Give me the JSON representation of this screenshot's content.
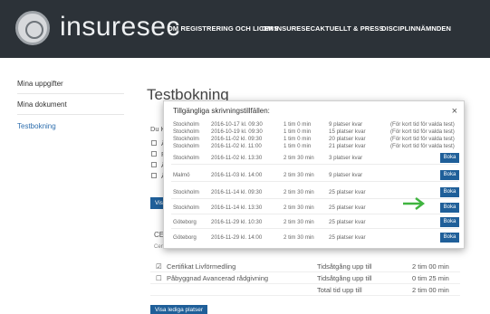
{
  "header": {
    "brand": "insuresec",
    "nav": [
      "OM REGISTRERING OCH LICENS",
      "OM INSURESEC",
      "AKTUELLT & PRESS",
      "DISCIPLINNÄMNDEN"
    ]
  },
  "sidebar": {
    "items": [
      {
        "label": "Mina uppgifter"
      },
      {
        "label": "Mina dokument"
      },
      {
        "label": "Testbokning"
      }
    ]
  },
  "page": {
    "title": "Testbokning",
    "intro_partial": "Du K",
    "checks_partial": [
      "Å",
      "P",
      "Å",
      "Å"
    ],
    "visa_button_partial": "Visa",
    "cert_partial": "CER",
    "cert_sub_partial": "Cert"
  },
  "summary": {
    "rows": [
      {
        "name": "Certifikat Livförmedling",
        "label": "Tidsåtgång upp till",
        "value": "2 tim 00 min",
        "checked": true
      },
      {
        "name": "Påbyggnad Avancerad rådgivning",
        "label": "Tidsåtgång upp till",
        "value": "0 tim 25 min",
        "checked": false
      },
      {
        "name": "",
        "label": "Total tid upp till",
        "value": "2 tim 00 min",
        "checked": null
      }
    ],
    "bottom_button": "Visa lediga platser"
  },
  "modal": {
    "title": "Tillgängliga skrivningstillfällen:",
    "close": "×",
    "book_label": "Boka",
    "rows": [
      {
        "city": "Stockholm",
        "datetime": "2016-10-17 kl. 09:30",
        "duration": "1 tim 0 min",
        "seats": "9 platser kvar",
        "note": "(För kort tid för valda test)",
        "bookable": false
      },
      {
        "city": "Stockholm",
        "datetime": "2016-10-19 kl. 09:30",
        "duration": "1 tim 0 min",
        "seats": "15 platser kvar",
        "note": "(För kort tid för valda test)",
        "bookable": false
      },
      {
        "city": "Stockholm",
        "datetime": "2016-11-02 kl. 09:30",
        "duration": "1 tim 0 min",
        "seats": "20 platser kvar",
        "note": "(För kort tid för valda test)",
        "bookable": false
      },
      {
        "city": "Stockholm",
        "datetime": "2016-11-02 kl. 11:00",
        "duration": "1 tim 0 min",
        "seats": "21 platser kvar",
        "note": "(För kort tid för valda test)",
        "bookable": false
      },
      {
        "city": "Stockholm",
        "datetime": "2016-11-02 kl. 13:30",
        "duration": "2 tim 30 min",
        "seats": "3 platser kvar",
        "note": "",
        "bookable": true
      },
      {
        "city": "Malmö",
        "datetime": "2016-11-03 kl. 14:00",
        "duration": "2 tim 30 min",
        "seats": "9 platser kvar",
        "note": "",
        "bookable": true
      },
      {
        "city": "Stockholm",
        "datetime": "2016-11-14 kl. 09:30",
        "duration": "2 tim 30 min",
        "seats": "25 platser kvar",
        "note": "",
        "bookable": true
      },
      {
        "city": "Stockholm",
        "datetime": "2016-11-14 kl. 13:30",
        "duration": "2 tim 30 min",
        "seats": "25 platser kvar",
        "note": "",
        "bookable": true
      },
      {
        "city": "Göteborg",
        "datetime": "2016-11-29 kl. 10:30",
        "duration": "2 tim 30 min",
        "seats": "25 platser kvar",
        "note": "",
        "bookable": true
      },
      {
        "city": "Göteborg",
        "datetime": "2016-11-29 kl. 14:00",
        "duration": "2 tim 30 min",
        "seats": "25 platser kvar",
        "note": "",
        "bookable": true
      }
    ]
  },
  "colors": {
    "header_bg": "#2c3238",
    "accent_blue": "#1f5f99",
    "arrow_green": "#3fb43f",
    "sidebar_active": "#2f6fae"
  }
}
